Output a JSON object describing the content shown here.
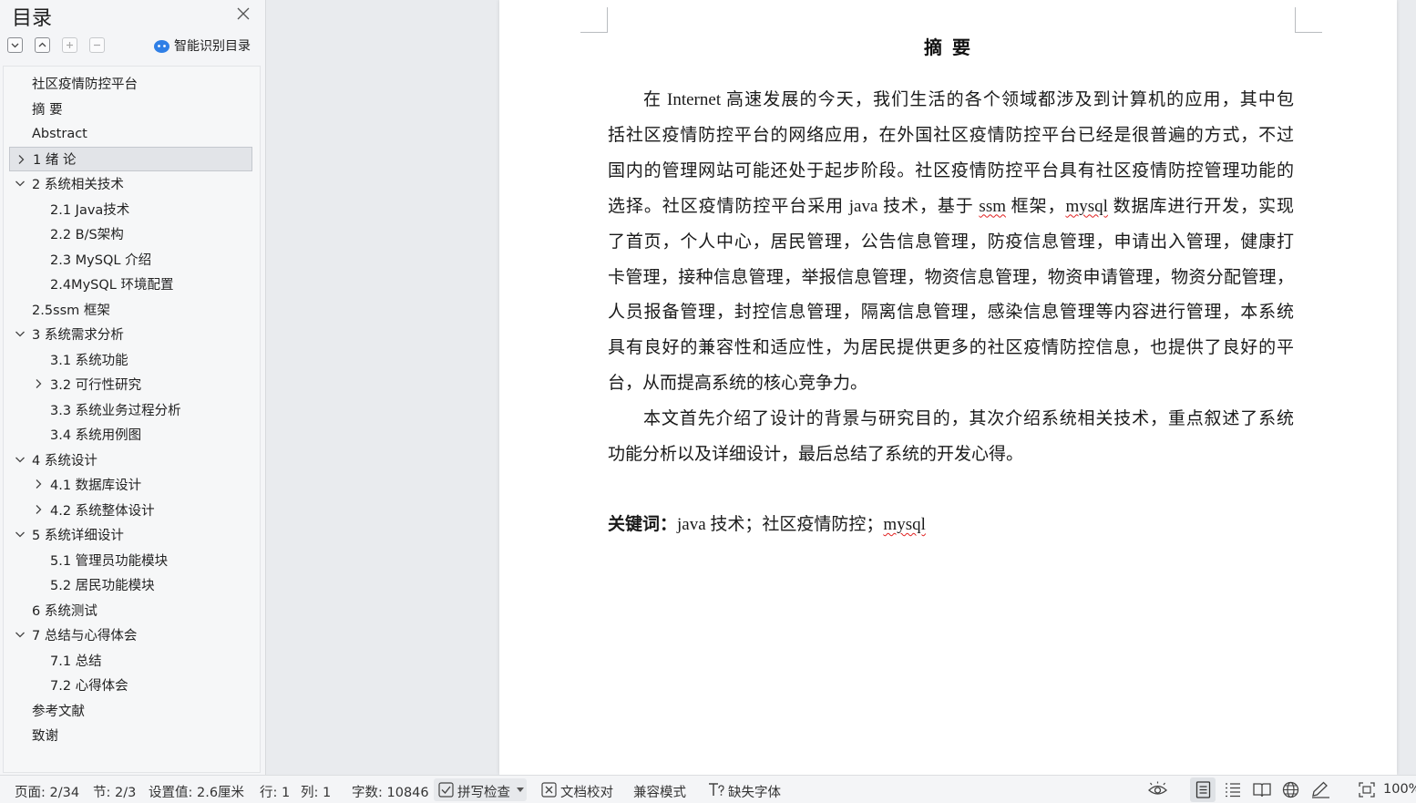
{
  "toc": {
    "title": "目录",
    "toolbar": {
      "expand_icon": "chevron-down-box-icon",
      "collapse_icon": "chevron-up-box-icon",
      "plus_icon": "plus-box-icon",
      "minus_icon": "minus-box-icon"
    },
    "smart_toc_label": "智能识别目录",
    "items": [
      {
        "label": "社区疫情防控平台",
        "level": 1,
        "chevron": "none"
      },
      {
        "label": "摘  要",
        "level": 1,
        "chevron": "none"
      },
      {
        "label": "Abstract",
        "level": 1,
        "chevron": "none"
      },
      {
        "label": "1  绪  论",
        "level": 1,
        "chevron": "right",
        "selected": true
      },
      {
        "label": "2 系统相关技术",
        "level": 1,
        "chevron": "down"
      },
      {
        "label": "2.1 Java技术",
        "level": 2,
        "chevron": "none"
      },
      {
        "label": "2.2 B/S架构",
        "level": 2,
        "chevron": "none"
      },
      {
        "label": "2.3 MySQL 介绍",
        "level": 2,
        "chevron": "none"
      },
      {
        "label": "2.4MySQL 环境配置",
        "level": 2,
        "chevron": "none"
      },
      {
        "label": "2.5ssm 框架",
        "level": 1,
        "chevron": "none"
      },
      {
        "label": "3 系统需求分析",
        "level": 1,
        "chevron": "down"
      },
      {
        "label": "3.1 系统功能",
        "level": 2,
        "chevron": "none"
      },
      {
        "label": "3.2 可行性研究",
        "level": 2,
        "chevron": "right"
      },
      {
        "label": "3.3 系统业务过程分析",
        "level": 2,
        "chevron": "none"
      },
      {
        "label": "3.4 系统用例图",
        "level": 2,
        "chevron": "none"
      },
      {
        "label": "4 系统设计",
        "level": 1,
        "chevron": "down"
      },
      {
        "label": "4.1 数据库设计",
        "level": 2,
        "chevron": "right"
      },
      {
        "label": "4.2 系统整体设计",
        "level": 2,
        "chevron": "right"
      },
      {
        "label": "5 系统详细设计",
        "level": 1,
        "chevron": "down"
      },
      {
        "label": "5.1 管理员功能模块",
        "level": 2,
        "chevron": "none"
      },
      {
        "label": "5.2 居民功能模块",
        "level": 2,
        "chevron": "none"
      },
      {
        "label": "6 系统测试",
        "level": 1,
        "chevron": "none"
      },
      {
        "label": "7 总结与心得体会",
        "level": 1,
        "chevron": "down"
      },
      {
        "label": "7.1 总结",
        "level": 2,
        "chevron": "none"
      },
      {
        "label": "7.2 心得体会",
        "level": 2,
        "chevron": "none"
      },
      {
        "label": "参考文献",
        "level": 1,
        "chevron": "none"
      },
      {
        "label": "致谢",
        "level": 1,
        "chevron": "none"
      }
    ]
  },
  "document": {
    "heading": "摘  要",
    "lines": [
      {
        "segments": [
          {
            "text": "在 Internet 高速发展的今天，我们生活的各个领域都涉及到计算机的应用，其中包"
          }
        ],
        "indent": true
      },
      {
        "segments": [
          {
            "text": "括社区疫情防控平台的网络应用，在外国社区疫情防控平台已经是很普遍的方式，不过"
          }
        ]
      },
      {
        "segments": [
          {
            "text": "国内的管理网站可能还处于起步阶段。社区疫情防控平台具有社区疫情防控管理功能的"
          }
        ]
      },
      {
        "segments": [
          {
            "text": "选择。社区疫情防控平台采用 java 技术，基于 "
          },
          {
            "text": "ssm",
            "misspelled": true
          },
          {
            "text": " 框架，"
          },
          {
            "text": "mysql",
            "misspelled": true
          },
          {
            "text": " 数据库进行开发，实现"
          }
        ]
      },
      {
        "segments": [
          {
            "text": "了首页，个人中心，居民管理，公告信息管理，防疫信息管理，申请出入管理，健康打"
          }
        ]
      },
      {
        "segments": [
          {
            "text": "卡管理，接种信息管理，举报信息管理，物资信息管理，物资申请管理，物资分配管理，"
          }
        ]
      },
      {
        "segments": [
          {
            "text": "人员报备管理，封控信息管理，隔离信息管理，感染信息管理等内容进行管理，本系统"
          }
        ]
      },
      {
        "segments": [
          {
            "text": "具有良好的兼容性和适应性，为居民提供更多的社区疫情防控信息，也提供了良好的平"
          }
        ]
      },
      {
        "segments": [
          {
            "text": "台，从而提高系统的核心竞争力。"
          }
        ],
        "last": true
      },
      {
        "segments": [
          {
            "text": "本文首先介绍了设计的背景与研究目的，其次介绍系统相关技术，重点叙述了系统"
          }
        ],
        "indent": true
      },
      {
        "segments": [
          {
            "text": "功能分析以及详细设计，最后总结了系统的开发心得。"
          }
        ],
        "last": true
      }
    ],
    "keywords_label": "关键词：",
    "keywords_pre": "java 技术；社区疫情防控；",
    "keywords_misspelled": "mysql"
  },
  "status_bar": {
    "page": "页面: 2/34",
    "section": "节: 2/3",
    "setting": "设置值: 2.6厘米",
    "row": "行: 1",
    "col": "列: 1",
    "word_count": "字数: 10846",
    "spellcheck": "拼写检查",
    "proofread": "文档校对",
    "compat_mode": "兼容模式",
    "missing_fonts": "缺失字体",
    "zoom": "100%"
  },
  "colors": {
    "accent": "#2f7fe6",
    "spell_error": "#e02020",
    "selected_bg": "#e2e4e8"
  }
}
